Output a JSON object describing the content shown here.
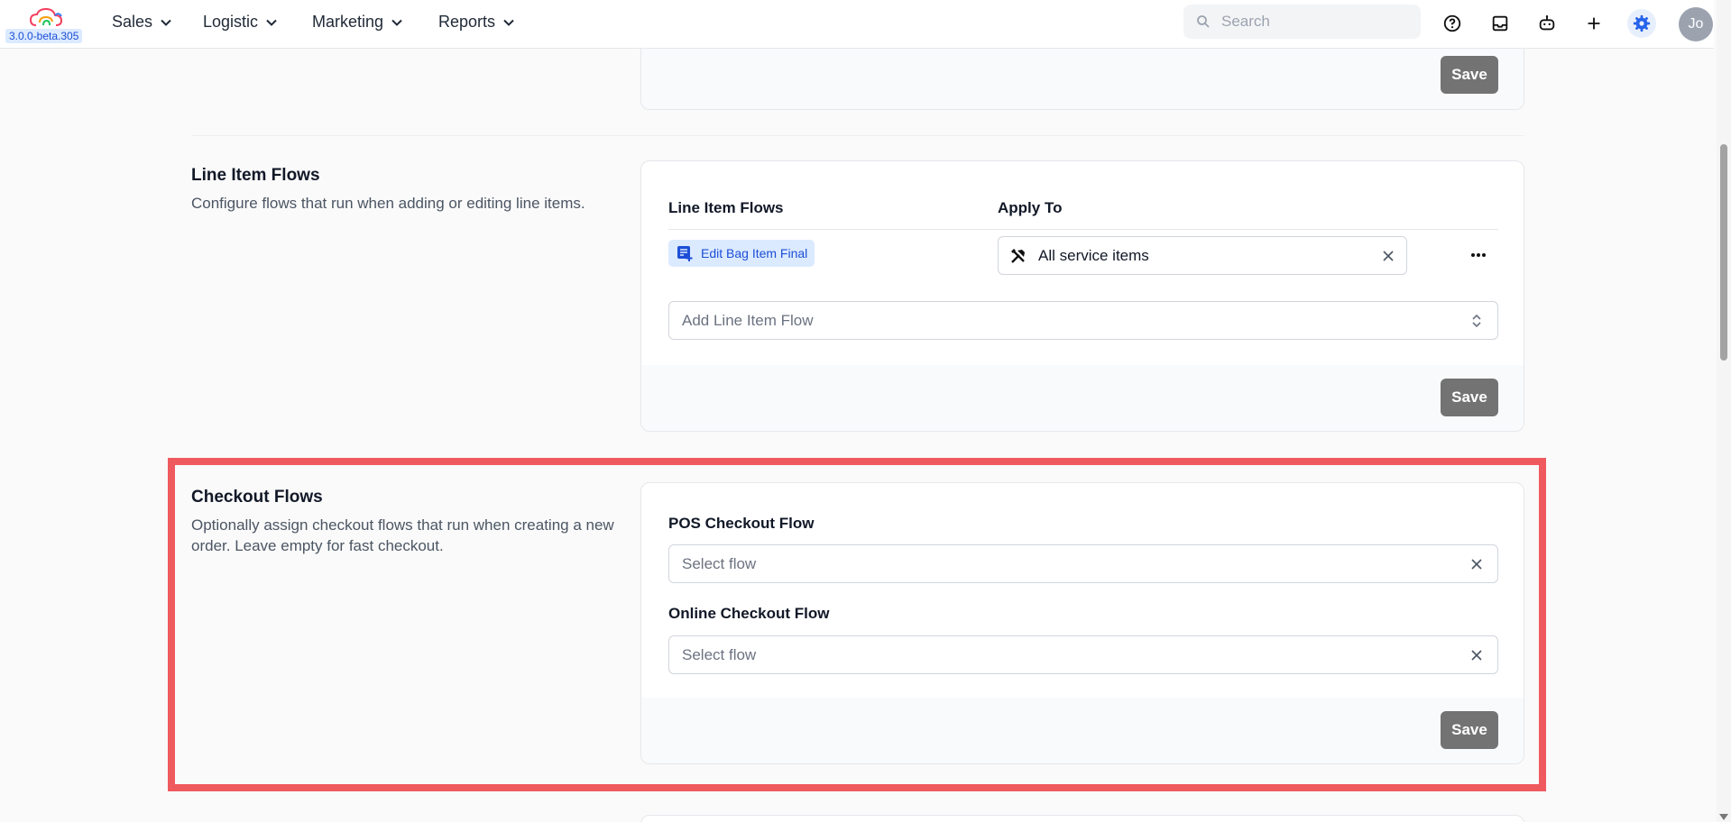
{
  "app": {
    "version": "3.0.0-beta.305",
    "brand_colors": [
      "#f43f5e",
      "#f59e0b",
      "#22c55e",
      "#3b82f6",
      "#a855f7"
    ]
  },
  "nav": {
    "items": [
      {
        "label": "Sales"
      },
      {
        "label": "Logistic"
      },
      {
        "label": "Marketing"
      },
      {
        "label": "Reports"
      }
    ],
    "search_placeholder": "Search",
    "icons": [
      "help-circle-icon",
      "inbox-icon",
      "bot-icon",
      "plus-icon",
      "gear-icon"
    ],
    "avatar_initials": "Jo"
  },
  "top_card": {
    "save_label": "Save"
  },
  "line_item_flows": {
    "title": "Line Item Flows",
    "description": "Configure flows that run when adding or editing line items.",
    "col_flows": "Line Item Flows",
    "col_apply": "Apply To",
    "rows": [
      {
        "flow": "Edit Bag Item Final",
        "apply_to": "All service items"
      }
    ],
    "add_placeholder": "Add Line Item Flow",
    "save_label": "Save"
  },
  "checkout_flows": {
    "title": "Checkout Flows",
    "description": "Optionally assign checkout flows that run when creating a new order. Leave empty for fast checkout.",
    "pos_label": "POS Checkout Flow",
    "pos_placeholder": "Select flow",
    "online_label": "Online Checkout Flow",
    "online_placeholder": "Select flow",
    "save_label": "Save",
    "highlight_color": "#ef5a5f"
  },
  "colors": {
    "accent": "#1d4ed8",
    "chip_bg": "#dbeafe",
    "save_bg": "#737373"
  }
}
